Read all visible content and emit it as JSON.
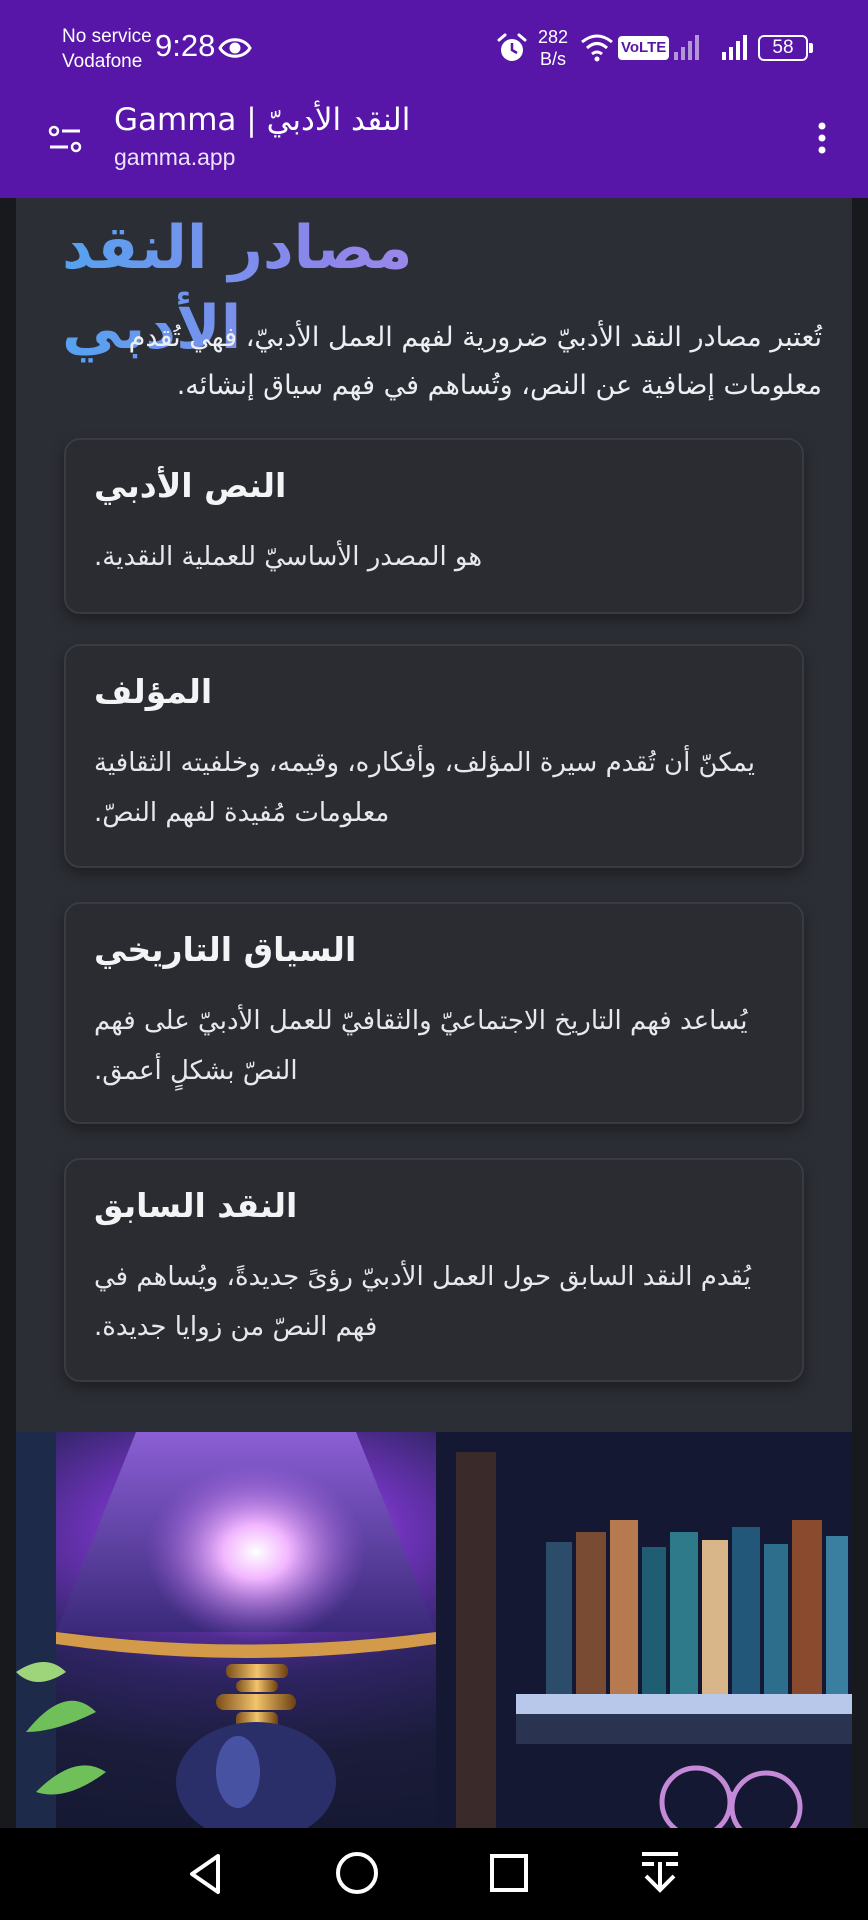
{
  "status_bar": {
    "carrier_line1": "No service",
    "carrier_line2": "Vodafone",
    "time": "9:28",
    "net_speed_value": "282",
    "net_speed_unit": "B/s",
    "volte": "VoLTE",
    "battery": "58"
  },
  "browser": {
    "tab_title": "Gamma | النقد الأدبيّ",
    "domain": "gamma.app"
  },
  "page": {
    "title": "مصادر النقد الأدبي",
    "intro": "تُعتبر مصادر النقد الأدبيّ ضرورية لفهم العمل الأدبيّ، فهي تُقدم معلومات إضافية عن النص، وتُساهم في فهم سياق إنشائه.",
    "cards": [
      {
        "title": "النص الأدبي",
        "body": "هو المصدر الأساسيّ للعملية النقدية."
      },
      {
        "title": "المؤلف",
        "body": "يمكنّ أن تُقدم سيرة المؤلف، وأفكاره، وقيمه، وخلفيته الثقافية معلومات مُفيدة لفهم النصّ."
      },
      {
        "title": "السياق التاريخي",
        "body": "يُساعد فهم التاريخ الاجتماعيّ والثقافيّ للعمل الأدبيّ على فهم النصّ بشكلٍ أعمق."
      },
      {
        "title": "النقد السابق",
        "body": "يُقدم النقد السابق حول العمل الأدبيّ رؤىً جديدةً، ويُساهم في فهم النصّ من زوايا جديدة."
      }
    ],
    "banner_alt": "lamp-and-bookshelf-illustration"
  },
  "colors": {
    "status_bar": "#5716a8",
    "page_bg": "#2c2e35",
    "card_bg": "#2a2c32",
    "title_gradient_start": "#56a2f0",
    "title_gradient_end": "#b48ee8"
  },
  "icons": [
    "eye-icon",
    "alarm-icon",
    "wifi-icon",
    "signal-icon",
    "site-settings-icon",
    "menu-icon",
    "back-icon",
    "home-icon",
    "recents-icon",
    "hide-keyboard-icon"
  ]
}
